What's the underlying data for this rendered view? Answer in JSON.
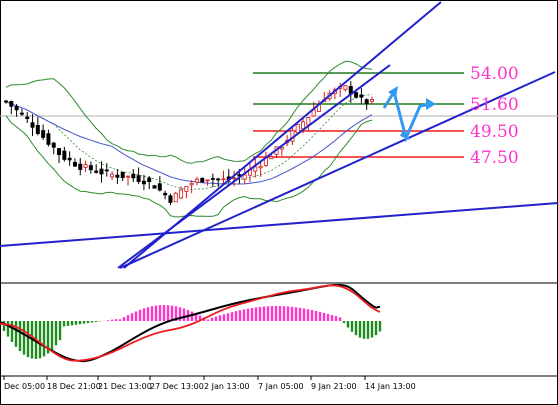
{
  "chart_data": {
    "type": "candlestick",
    "title": "",
    "x_tick_labels": [
      "Dec 05:00",
      "18 Dec 21:00",
      "21 Dec 13:00",
      "27 Dec 13:00",
      "2 Jan 13:00",
      "7 Jan 05:00",
      "9 Jan 21:00",
      "14 Jan 13:00"
    ],
    "price_levels": [
      {
        "label": "54.00",
        "value": 54.0,
        "line_color": "#1e7b1e",
        "label_color": "#ff33cc"
      },
      {
        "label": "51.60",
        "value": 51.6,
        "line_color": "#1e7b1e",
        "label_color": "#ff33cc"
      },
      {
        "label": "49.50",
        "value": 49.5,
        "line_color": "#ee1c1c",
        "label_color": "#ff33cc"
      },
      {
        "label": "47.50",
        "value": 47.5,
        "line_color": "#ee1c1c",
        "label_color": "#ff33cc"
      }
    ],
    "colors": {
      "bull_candle": "#ffffff",
      "bear_candle": "#000000",
      "bull_wick": "#d31a1a",
      "bollinger": "#2e8b2e",
      "moving_average": "#4455cc",
      "trend_line": "#2222cc",
      "forecast_arrow": "#3399ee",
      "histogram_positive": "#ff33cc",
      "histogram_negative": "#1e8b1e",
      "macd_line": "#000000",
      "signal_line": "#ee1c1c",
      "current_price_line": "#b0b0b0"
    },
    "price_series_approx": [
      51.8,
      51.2,
      50.6,
      49.9,
      49.1,
      48.4,
      47.6,
      47.2,
      46.8,
      46.6,
      46.4,
      46.2,
      46.1,
      46.0,
      45.9,
      45.7,
      45.4,
      44.8,
      44.2,
      44.8,
      45.4,
      45.7,
      45.9,
      45.8,
      45.7,
      45.9,
      46.1,
      46.6,
      47.1,
      47.7,
      48.3,
      49.1,
      49.9,
      50.6,
      51.5,
      52.3,
      52.6,
      52.9,
      52.4,
      51.8,
      51.7
    ]
  }
}
